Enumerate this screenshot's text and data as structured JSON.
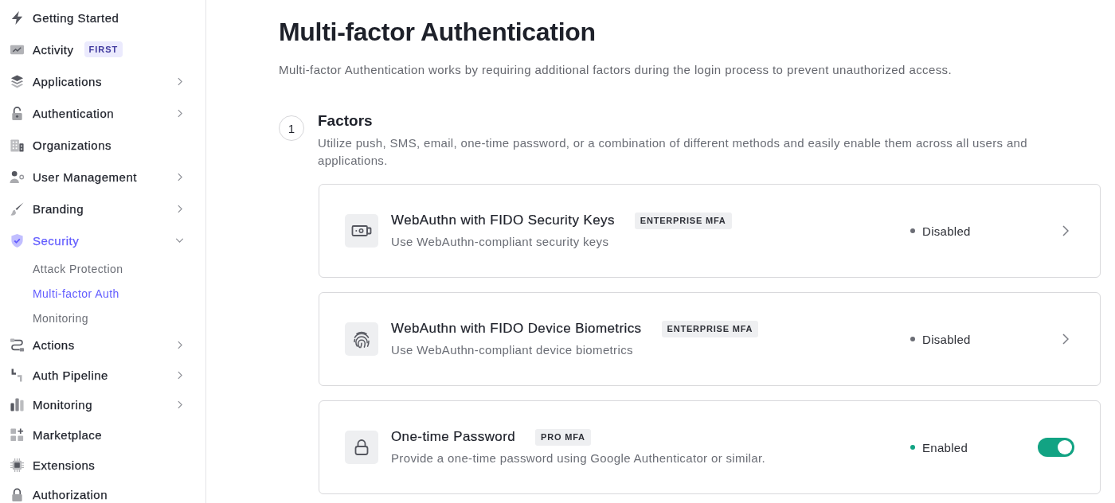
{
  "sidebar": {
    "items": [
      {
        "label": "Getting Started",
        "kind": "link",
        "selected": false
      },
      {
        "label": "Activity",
        "kind": "link",
        "selected": false,
        "badge": "FIRST"
      },
      {
        "label": "Applications",
        "kind": "group",
        "expanded": false,
        "selected": false
      },
      {
        "label": "Authentication",
        "kind": "group",
        "expanded": false,
        "selected": false
      },
      {
        "label": "Organizations",
        "kind": "link",
        "selected": false
      },
      {
        "label": "User Management",
        "kind": "group",
        "expanded": false,
        "selected": false
      },
      {
        "label": "Branding",
        "kind": "group",
        "expanded": false,
        "selected": false
      },
      {
        "label": "Security",
        "kind": "group",
        "expanded": true,
        "selected": true,
        "children": [
          {
            "label": "Attack Protection",
            "selected": false
          },
          {
            "label": "Multi-factor Auth",
            "selected": true
          },
          {
            "label": "Monitoring",
            "selected": false
          }
        ]
      },
      {
        "label": "Actions",
        "kind": "group",
        "expanded": false,
        "selected": false
      },
      {
        "label": "Auth Pipeline",
        "kind": "group",
        "expanded": false,
        "selected": false
      },
      {
        "label": "Monitoring",
        "kind": "group",
        "expanded": false,
        "selected": false
      },
      {
        "label": "Marketplace",
        "kind": "link",
        "selected": false
      },
      {
        "label": "Extensions",
        "kind": "link",
        "selected": false
      },
      {
        "label": "Authorization",
        "kind": "link",
        "selected": false
      }
    ]
  },
  "page": {
    "title": "Multi-factor Authentication",
    "description": "Multi-factor Authentication works by requiring additional factors during the login process to prevent unauthorized access."
  },
  "steps": [
    {
      "number": "1",
      "title": "Factors",
      "description": "Utilize push, SMS, email, one-time password, or a combination of different methods and easily enable them across all users and applications.",
      "factors": [
        {
          "name": "WebAuthn with FIDO Security Keys",
          "badge": "ENTERPRISE MFA",
          "description": "Use WebAuthn-compliant security keys",
          "status": {
            "label": "Disabled",
            "enabled": false
          },
          "kind": "link"
        },
        {
          "name": "WebAuthn with FIDO Device Biometrics",
          "badge": "ENTERPRISE MFA",
          "description": "Use WebAuthn-compliant device biometrics",
          "status": {
            "label": "Disabled",
            "enabled": false
          },
          "kind": "link"
        },
        {
          "name": "One-time Password",
          "badge": "PRO MFA",
          "description": "Provide a one-time password using Google Authenticator or similar.",
          "status": {
            "label": "Enabled",
            "enabled": true
          },
          "kind": "toggle",
          "on": true
        }
      ]
    }
  ]
}
